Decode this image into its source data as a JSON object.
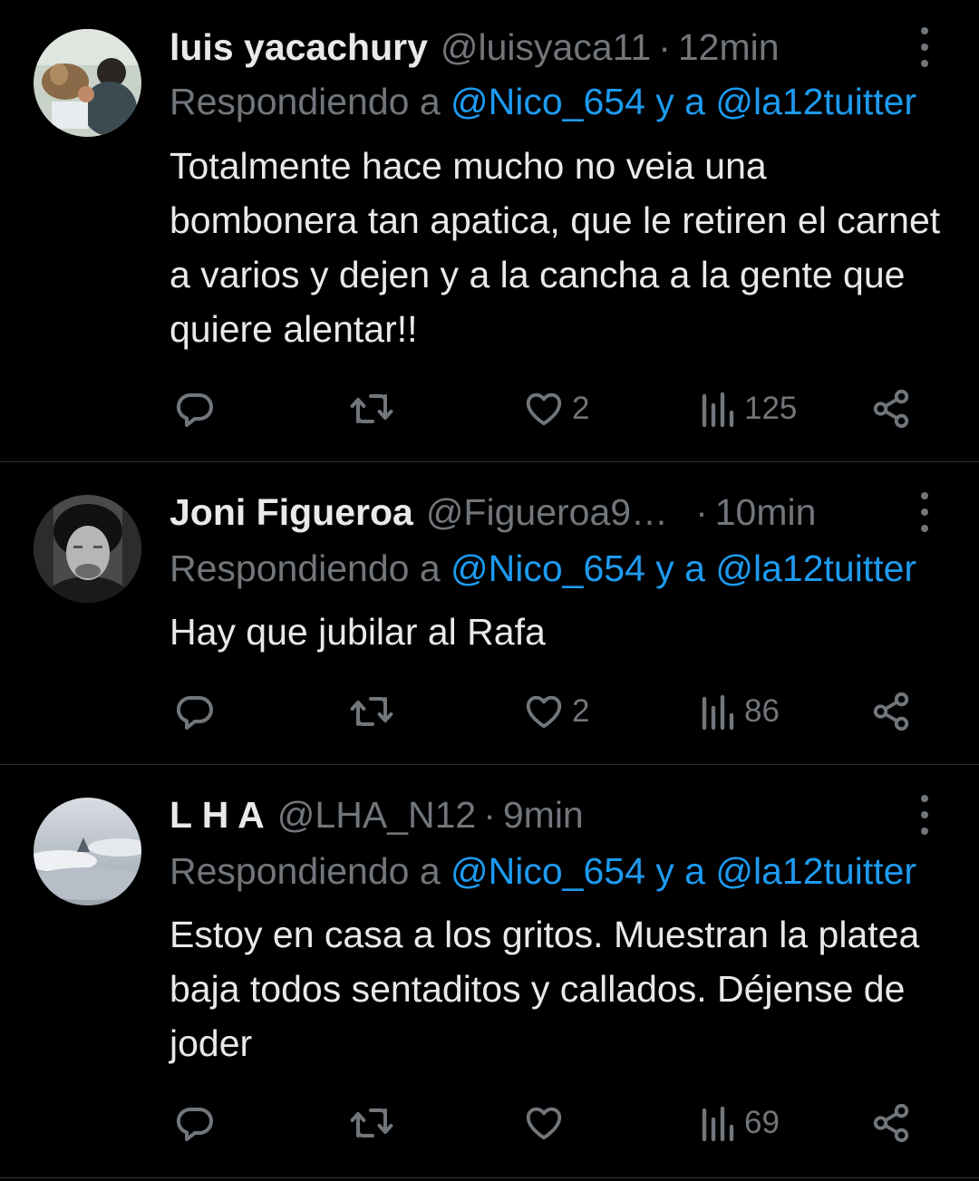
{
  "tweets": [
    {
      "name": "luis yacachury",
      "handle": "@luisyaca11",
      "separator": "·",
      "time": "12min",
      "reply_prefix": "Respondiendo a ",
      "reply_mention1": "@Nico_654",
      "reply_joiner": " y a ",
      "reply_mention2": "@la12tuitter",
      "body": "Totalmente hace mucho no veia una bombonera tan apatica, que le retiren el carnet a varios y dejen y a la cancha a la gente que quiere alentar!!",
      "likes": "2",
      "views": "125",
      "avatar": "photo-dogs"
    },
    {
      "name": "Joni Figueroa",
      "handle": "@Figueroa9…",
      "separator": "·",
      "time": "10min",
      "reply_prefix": "Respondiendo a ",
      "reply_mention1": "@Nico_654",
      "reply_joiner": " y a ",
      "reply_mention2": "@la12tuitter",
      "body": "Hay que jubilar al Rafa",
      "likes": "2",
      "views": "86",
      "avatar": "photo-bw-portrait"
    },
    {
      "name": "L H A",
      "handle": "@LHA_N12",
      "separator": "·",
      "time": "9min",
      "reply_prefix": "Respondiendo a ",
      "reply_mention1": "@Nico_654",
      "reply_joiner": " y a ",
      "reply_mention2": "@la12tuitter",
      "body": "Estoy en casa a los gritos. Muestran la platea baja todos sentaditos y callados. Déjense de joder",
      "likes": "",
      "views": "69",
      "avatar": "photo-cloudy-sky"
    }
  ],
  "icons": {
    "reply": "reply-icon",
    "retweet": "retweet-icon",
    "like": "heart-icon",
    "views": "views-icon",
    "share": "share-icon",
    "more": "more-vertical-icon"
  },
  "colors": {
    "background": "#000000",
    "text": "#e7e9ea",
    "muted": "#71767b",
    "link": "#1d9bf0",
    "divider": "#2f3336"
  }
}
